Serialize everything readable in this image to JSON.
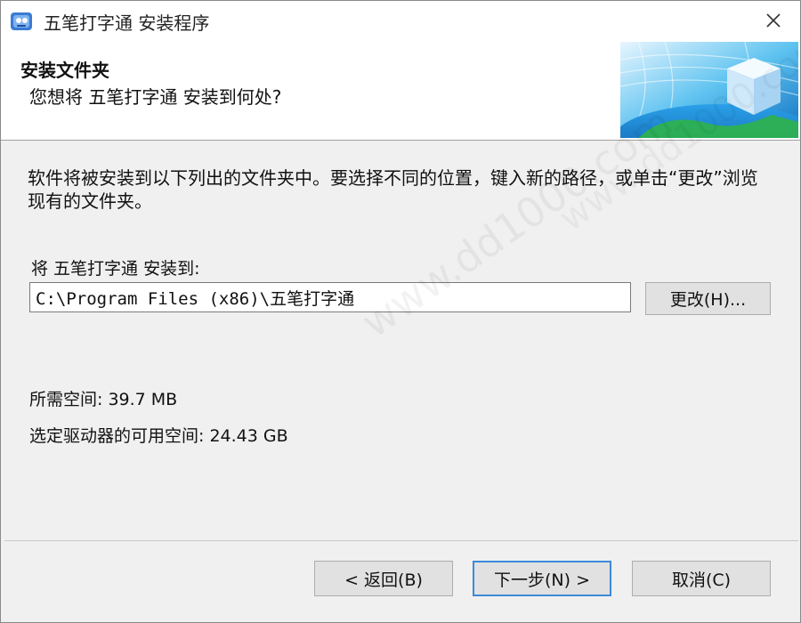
{
  "window": {
    "title": "五笔打字通 安装程序"
  },
  "header": {
    "title": "安装文件夹",
    "subtitle": "您想将 五笔打字通 安装到何处?"
  },
  "body": {
    "description": "软件将被安装到以下列出的文件夹中。要选择不同的位置，键入新的路径，或单击“更改”浏览现有的文件夹。",
    "install_to_label": "将 五笔打字通 安装到:",
    "path_value": "C:\\Program Files (x86)\\五笔打字通",
    "change_button": "更改(H)...",
    "space_required": "所需空间: 39.7 MB",
    "space_available": "选定驱动器的可用空间: 24.43 GB"
  },
  "footer": {
    "back_button": "< 返回(B)",
    "next_button": "下一步(N) >",
    "cancel_button": "取消(C)"
  },
  "watermark": {
    "text": "www.dd1000.com"
  },
  "colors": {
    "window_bg": "#f0f0f0",
    "header_bg": "#ffffff",
    "button_bg": "#e1e1e1",
    "default_button_border": "#3c8ad8"
  },
  "icons": {
    "app": "installer-app-icon",
    "close": "close-icon",
    "banner": "install-box-globe-graphic"
  }
}
